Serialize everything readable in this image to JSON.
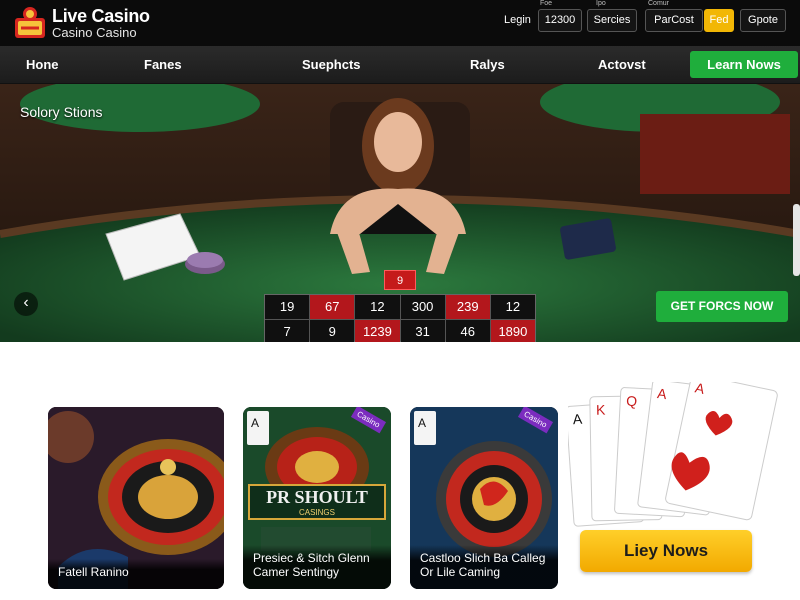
{
  "header": {
    "brand_title": "Live Casino",
    "brand_subtitle": "Casino Casino",
    "tiny_labels": [
      "Foe",
      "Ipo",
      "Comur"
    ],
    "login_label": "Legin",
    "buttons": [
      "12300",
      "Sercies",
      "ParCost",
      "Fed",
      "Gpote"
    ]
  },
  "nav": {
    "items": [
      "Hone",
      "Fanes",
      "Suephcts",
      "Ralys",
      "Actovst"
    ],
    "cta_label": "Learn Nows"
  },
  "hero": {
    "label": "Solory Stions",
    "chip_value": "9",
    "board_top": [
      "19",
      "67",
      "12",
      "300",
      "239",
      "12"
    ],
    "board_bottom": [
      "7",
      "9",
      "1239",
      "31",
      "46",
      "1890"
    ],
    "cta_label": "GET FORCS NOW",
    "prev_glyph": "‹"
  },
  "cards": [
    {
      "caption": "Fatell Ranino",
      "badge": ""
    },
    {
      "caption": "Presiec & Sitch Glenn Camer Sentingy",
      "badge": "Casino",
      "overlay_title": "PR SHOULT",
      "overlay_sub": "CASINGS"
    },
    {
      "caption": "Castloo Slich Ba Calleg Or Lile Caming",
      "badge": "Casino"
    }
  ],
  "playing_cards": [
    "A",
    "K",
    "Q",
    "A",
    "A"
  ],
  "play_button": "Liey Nows",
  "colors": {
    "accent_green": "#1fae3c",
    "accent_gold": "#f2b705",
    "felt_green": "#1e5a2e"
  }
}
